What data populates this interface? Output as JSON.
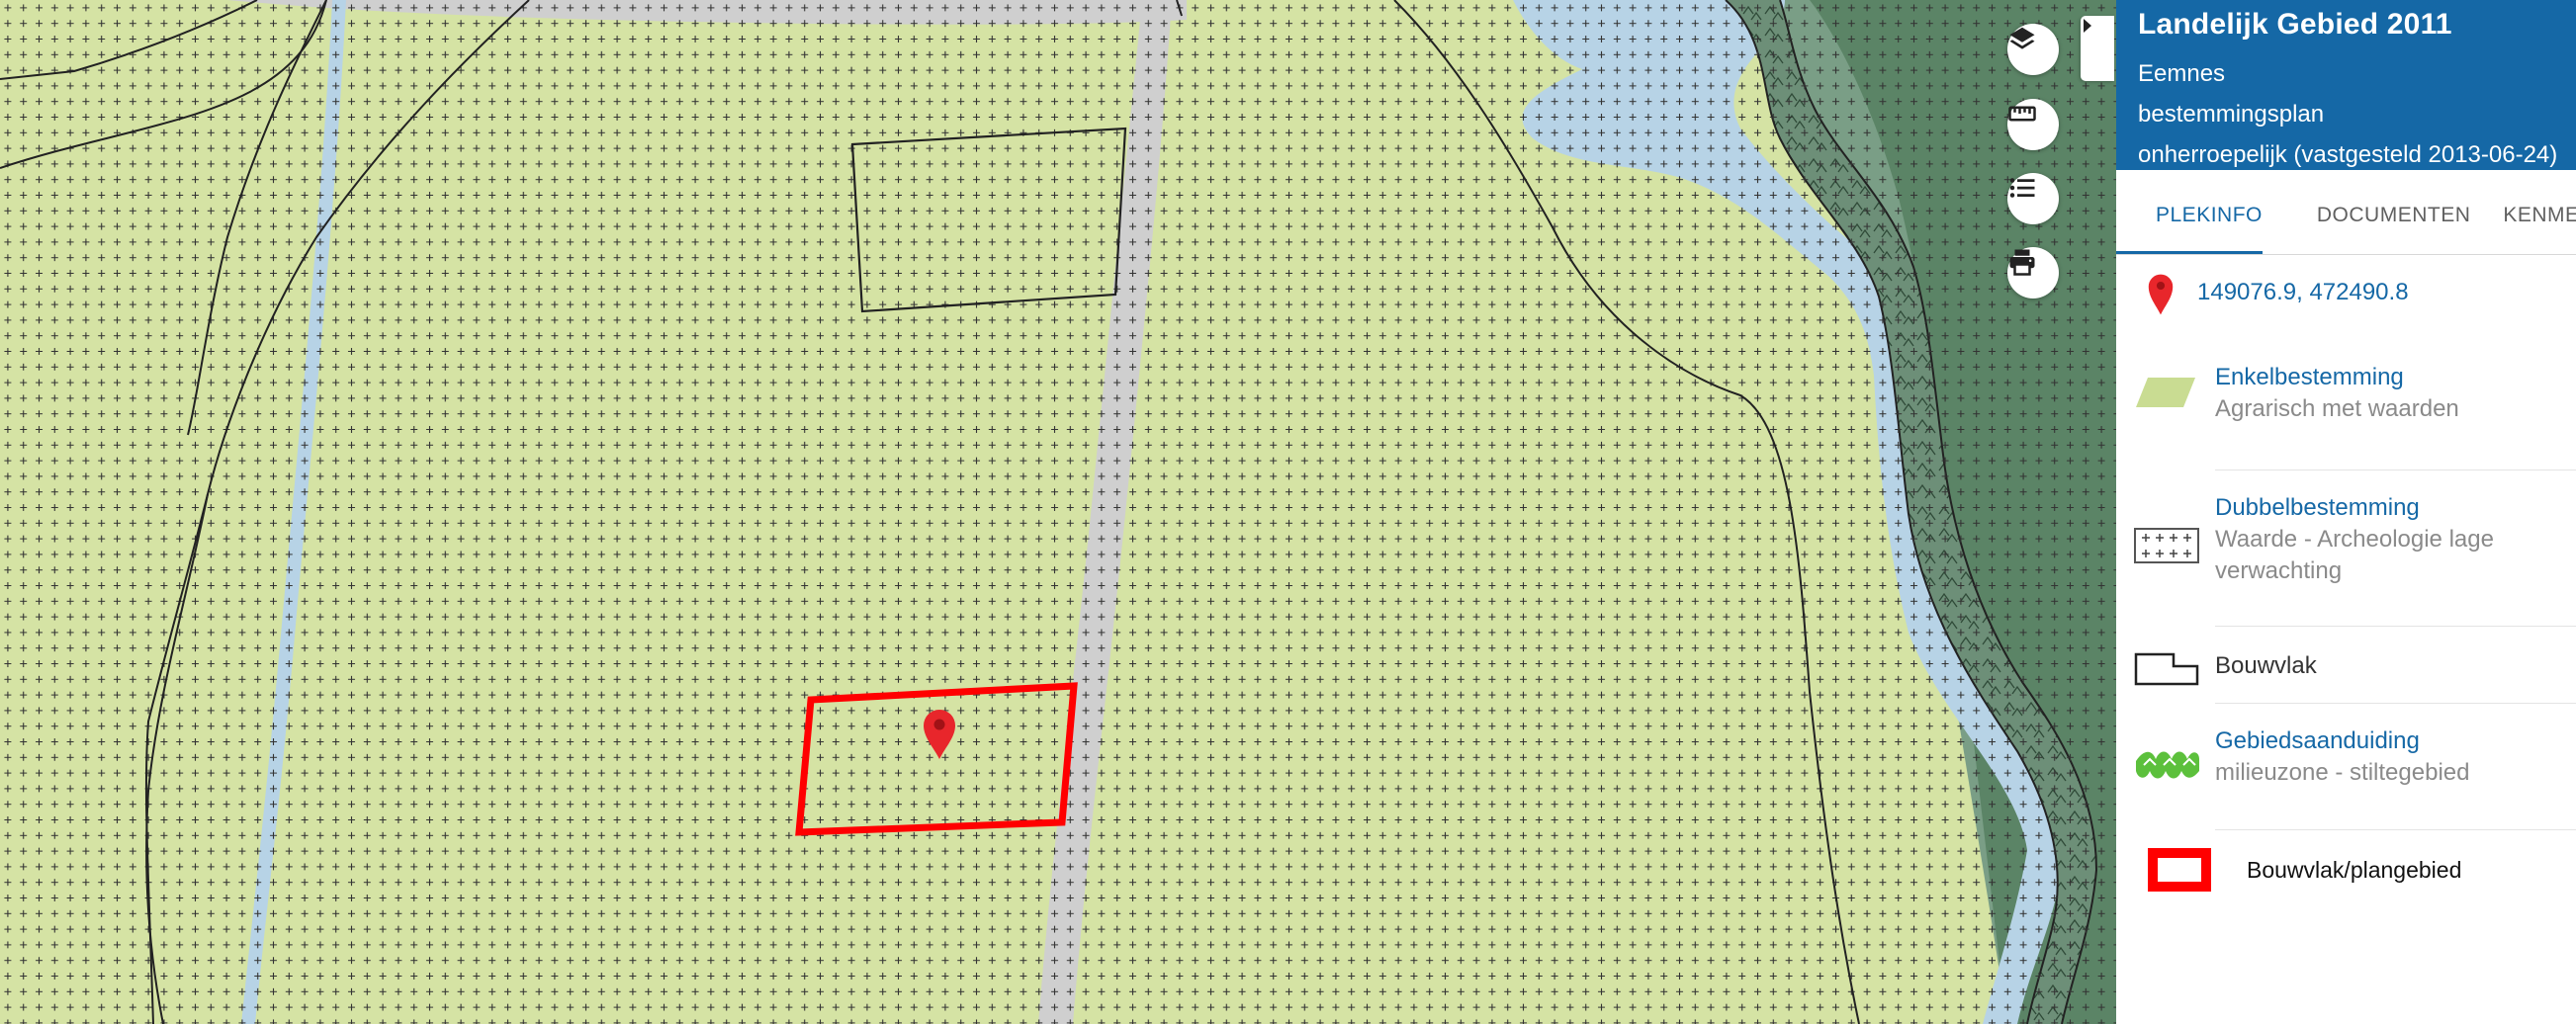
{
  "plan": {
    "title": "Landelijk Gebied 2011",
    "municipality": "Eemnes",
    "type": "bestemmingsplan",
    "status": "onherroepelijk (vastgesteld 2013-06-24)"
  },
  "tabs": [
    {
      "label": "PLEKINFO",
      "active": true
    },
    {
      "label": "DOCUMENTEN",
      "active": false
    },
    {
      "label": "KENMERKEN",
      "active": false
    }
  ],
  "location": {
    "coordinates": "149076.9, 472490.8",
    "icon": "map-pin-icon"
  },
  "legend": {
    "enkelbestemming": {
      "title": "Enkelbestemming",
      "value": "Agrarisch met waarden",
      "color": "#c9dc92"
    },
    "dubbelbestemming": {
      "title": "Dubbelbestemming",
      "value": "Waarde - Archeologie lage verwachting"
    },
    "bouwvlak": {
      "label": "Bouwvlak"
    },
    "gebiedsaanduiding": {
      "title": "Gebiedsaanduiding",
      "value": "milieuzone - stiltegebied",
      "color": "#5cc03c"
    },
    "plangebied": {
      "label": "Bouwvlak/plangebied",
      "color": "#ff0000"
    }
  },
  "tools": {
    "layers": "layers-icon",
    "measure": "ruler-icon",
    "legend": "list-icon",
    "print": "printer-icon",
    "toggle": "chevron-right-icon"
  },
  "colors": {
    "header": "#1568a6",
    "map_agricultural": "#d5e3a4",
    "map_road": "#cfcfcf",
    "map_water": "#b7d3e6",
    "map_nature": "#7a9e86",
    "selection": "#ff0000"
  }
}
